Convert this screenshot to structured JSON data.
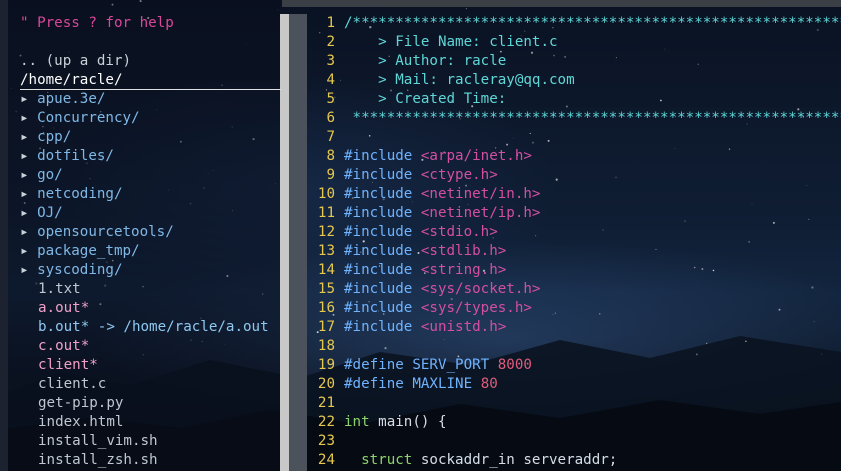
{
  "tree": {
    "help": "\" Press ? for help",
    "up": ".. (up a dir)",
    "cwd": "/home/racle/",
    "arrow": "▸",
    "dirs": [
      "apue.3e/",
      "Concurrency/",
      "cpp/",
      "dotfiles/",
      "go/",
      "netcoding/",
      "OJ/",
      "opensourcetools/",
      "package_tmp/",
      "syscoding/"
    ],
    "files": [
      {
        "name": "1.txt",
        "kind": "plain"
      },
      {
        "name": "a.out*",
        "kind": "exe"
      },
      {
        "name": "b.out* -> /home/racle/a.out",
        "kind": "link"
      },
      {
        "name": "c.out*",
        "kind": "exe"
      },
      {
        "name": "client*",
        "kind": "exe"
      },
      {
        "name": "client.c",
        "kind": "plain"
      },
      {
        "name": "get-pip.py",
        "kind": "plain"
      },
      {
        "name": "index.html",
        "kind": "plain"
      },
      {
        "name": "install_vim.sh",
        "kind": "plain"
      },
      {
        "name": "install_zsh.sh",
        "kind": "plain"
      }
    ]
  },
  "editor": {
    "lines": [
      {
        "n": "1",
        "parts": [
          [
            "cm",
            "/**********************************************************"
          ]
        ]
      },
      {
        "n": "2",
        "parts": [
          [
            "cm",
            "    > File Name: client.c"
          ]
        ]
      },
      {
        "n": "3",
        "parts": [
          [
            "cm",
            "    > Author: racle"
          ]
        ]
      },
      {
        "n": "4",
        "parts": [
          [
            "cm",
            "    > Mail: racleray@qq.com"
          ]
        ]
      },
      {
        "n": "5",
        "parts": [
          [
            "cm",
            "    > Created Time:"
          ]
        ]
      },
      {
        "n": "6",
        "parts": [
          [
            "cm",
            " **********************************************************"
          ]
        ]
      },
      {
        "n": "7",
        "parts": []
      },
      {
        "n": "8",
        "parts": [
          [
            "kw",
            "#include "
          ],
          [
            "str",
            "<arpa/inet.h>"
          ]
        ]
      },
      {
        "n": "9",
        "parts": [
          [
            "kw",
            "#include "
          ],
          [
            "str",
            "<ctype.h>"
          ]
        ]
      },
      {
        "n": "10",
        "parts": [
          [
            "kw",
            "#include "
          ],
          [
            "str",
            "<netinet/in.h>"
          ]
        ]
      },
      {
        "n": "11",
        "parts": [
          [
            "kw",
            "#include "
          ],
          [
            "str",
            "<netinet/ip.h>"
          ]
        ]
      },
      {
        "n": "12",
        "parts": [
          [
            "kw",
            "#include "
          ],
          [
            "str",
            "<stdio.h>"
          ]
        ]
      },
      {
        "n": "13",
        "parts": [
          [
            "kw",
            "#include "
          ],
          [
            "str",
            "<stdlib.h>"
          ]
        ]
      },
      {
        "n": "14",
        "parts": [
          [
            "kw",
            "#include "
          ],
          [
            "str",
            "<string.h>"
          ]
        ]
      },
      {
        "n": "15",
        "parts": [
          [
            "kw",
            "#include "
          ],
          [
            "str",
            "<sys/socket.h>"
          ]
        ]
      },
      {
        "n": "16",
        "parts": [
          [
            "kw",
            "#include "
          ],
          [
            "str",
            "<sys/types.h>"
          ]
        ]
      },
      {
        "n": "17",
        "parts": [
          [
            "kw",
            "#include "
          ],
          [
            "str",
            "<unistd.h>"
          ]
        ]
      },
      {
        "n": "18",
        "parts": []
      },
      {
        "n": "19",
        "parts": [
          [
            "kw",
            "#define "
          ],
          [
            "kw",
            "SERV_PORT "
          ],
          [
            "num",
            "8000"
          ]
        ]
      },
      {
        "n": "20",
        "parts": [
          [
            "kw",
            "#define "
          ],
          [
            "kw",
            "MAXLINE "
          ],
          [
            "num",
            "80"
          ]
        ]
      },
      {
        "n": "21",
        "parts": []
      },
      {
        "n": "22",
        "parts": [
          [
            "ty",
            "int "
          ],
          [
            "fg",
            "main() {"
          ]
        ]
      },
      {
        "n": "23",
        "parts": []
      },
      {
        "n": "24",
        "parts": [
          [
            "fg",
            "  "
          ],
          [
            "ty",
            "struct "
          ],
          [
            "fg",
            "sockaddr_in serveraddr;"
          ]
        ]
      }
    ]
  }
}
